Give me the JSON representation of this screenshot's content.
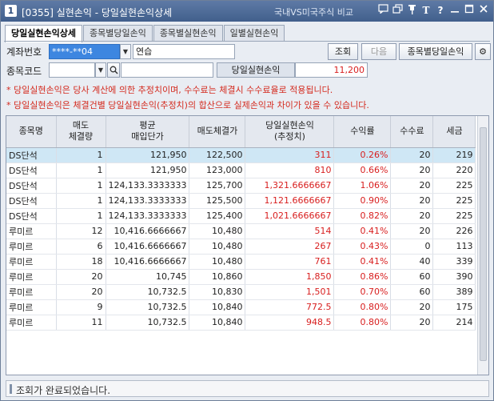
{
  "window": {
    "number": "1",
    "title": "[0355] 실현손익 - 당일실현손익상세",
    "compare_link": "국내VS미국주식 비교",
    "icons": [
      "chat-icon",
      "copy-icon",
      "pin-icon",
      "font-size-icon",
      "help-icon",
      "minimize-icon",
      "maximize-icon",
      "close-icon"
    ]
  },
  "tabs": [
    {
      "label": "당일실현손익상세",
      "active": true
    },
    {
      "label": "종목별당일손익",
      "active": false
    },
    {
      "label": "종목별실현손익",
      "active": false
    },
    {
      "label": "일별실현손익",
      "active": false
    }
  ],
  "form": {
    "account_label": "계좌번호",
    "account_value": "****-**04",
    "account_name": "연습",
    "stock_code_label": "종목코드",
    "stock_code_value": "",
    "stock_name_value": "",
    "today_pnl_label": "당일실현손익",
    "today_pnl_value": "11,200",
    "query_button": "조회",
    "next_button": "다음",
    "by_stock_button": "종목별당일손익"
  },
  "notices": [
    "* 당일실현손익은 당사 계산에 의한 추정치이며, 수수료는 체결시 수수료율로 적용됩니다.",
    "* 당일실현손익은 체결건별 당일실현손익(추정치)의 합산으로 실제손익과 차이가 있을 수 있습니다."
  ],
  "table": {
    "columns": [
      {
        "line1": "종목명",
        "line2": ""
      },
      {
        "line1": "매도",
        "line2": "체결량"
      },
      {
        "line1": "평균",
        "line2": "매입단가"
      },
      {
        "line1": "매도체결가",
        "line2": ""
      },
      {
        "line1": "당일실현손익",
        "line2": "(추정치)"
      },
      {
        "line1": "수익률",
        "line2": ""
      },
      {
        "line1": "수수료",
        "line2": ""
      },
      {
        "line1": "세금",
        "line2": ""
      }
    ],
    "rows": [
      {
        "name": "DS단석",
        "qty": "1",
        "avg": "121,950",
        "sell": "122,500",
        "pnl": "311",
        "rate": "0.26%",
        "fee": "20",
        "tax": "219",
        "selected": true
      },
      {
        "name": "DS단석",
        "qty": "1",
        "avg": "121,950",
        "sell": "123,000",
        "pnl": "810",
        "rate": "0.66%",
        "fee": "20",
        "tax": "220"
      },
      {
        "name": "DS단석",
        "qty": "1",
        "avg": "124,133.3333333",
        "sell": "125,700",
        "pnl": "1,321.6666667",
        "rate": "1.06%",
        "fee": "20",
        "tax": "225"
      },
      {
        "name": "DS단석",
        "qty": "1",
        "avg": "124,133.3333333",
        "sell": "125,500",
        "pnl": "1,121.6666667",
        "rate": "0.90%",
        "fee": "20",
        "tax": "225"
      },
      {
        "name": "DS단석",
        "qty": "1",
        "avg": "124,133.3333333",
        "sell": "125,400",
        "pnl": "1,021.6666667",
        "rate": "0.82%",
        "fee": "20",
        "tax": "225"
      },
      {
        "name": "루미르",
        "qty": "12",
        "avg": "10,416.6666667",
        "sell": "10,480",
        "pnl": "514",
        "rate": "0.41%",
        "fee": "20",
        "tax": "226"
      },
      {
        "name": "루미르",
        "qty": "6",
        "avg": "10,416.6666667",
        "sell": "10,480",
        "pnl": "267",
        "rate": "0.43%",
        "fee": "0",
        "tax": "113"
      },
      {
        "name": "루미르",
        "qty": "18",
        "avg": "10,416.6666667",
        "sell": "10,480",
        "pnl": "761",
        "rate": "0.41%",
        "fee": "40",
        "tax": "339"
      },
      {
        "name": "루미르",
        "qty": "20",
        "avg": "10,745",
        "sell": "10,860",
        "pnl": "1,850",
        "rate": "0.86%",
        "fee": "60",
        "tax": "390"
      },
      {
        "name": "루미르",
        "qty": "20",
        "avg": "10,732.5",
        "sell": "10,830",
        "pnl": "1,501",
        "rate": "0.70%",
        "fee": "60",
        "tax": "389"
      },
      {
        "name": "루미르",
        "qty": "9",
        "avg": "10,732.5",
        "sell": "10,840",
        "pnl": "772.5",
        "rate": "0.80%",
        "fee": "20",
        "tax": "175"
      },
      {
        "name": "루미르",
        "qty": "11",
        "avg": "10,732.5",
        "sell": "10,840",
        "pnl": "948.5",
        "rate": "0.80%",
        "fee": "20",
        "tax": "214"
      }
    ]
  },
  "status": {
    "message": "조회가 완료되었습니다."
  },
  "colors": {
    "profit": "#d81e1e",
    "notice": "#d42a1e",
    "selected_row": "#cfe7f5",
    "title_bar": "#4a6896"
  }
}
